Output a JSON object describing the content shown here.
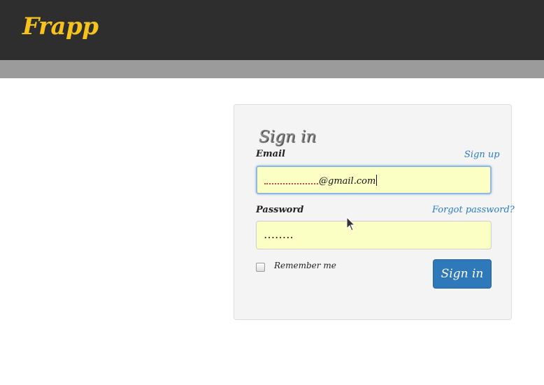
{
  "header": {
    "brand": "Frapp"
  },
  "signin_panel": {
    "title": "Sign in",
    "email": {
      "label": "Email",
      "link": "Sign up",
      "value_suffix": "@gmail.com"
    },
    "password": {
      "label": "Password",
      "link": "Forgot password?",
      "masked_value": "․․․․․․․․"
    },
    "remember": {
      "label": "Remember me",
      "checked": false
    },
    "submit_label": "Sign in"
  },
  "colors": {
    "header_bg": "#2e2e2e",
    "brand": "#f6c31d",
    "subbar": "#9b9b9b",
    "input_bg": "#fbffc3",
    "link": "#2a7ec6",
    "button": "#2f78b9"
  },
  "icons": {
    "mouse_cursor": "arrow-pointer-icon"
  }
}
